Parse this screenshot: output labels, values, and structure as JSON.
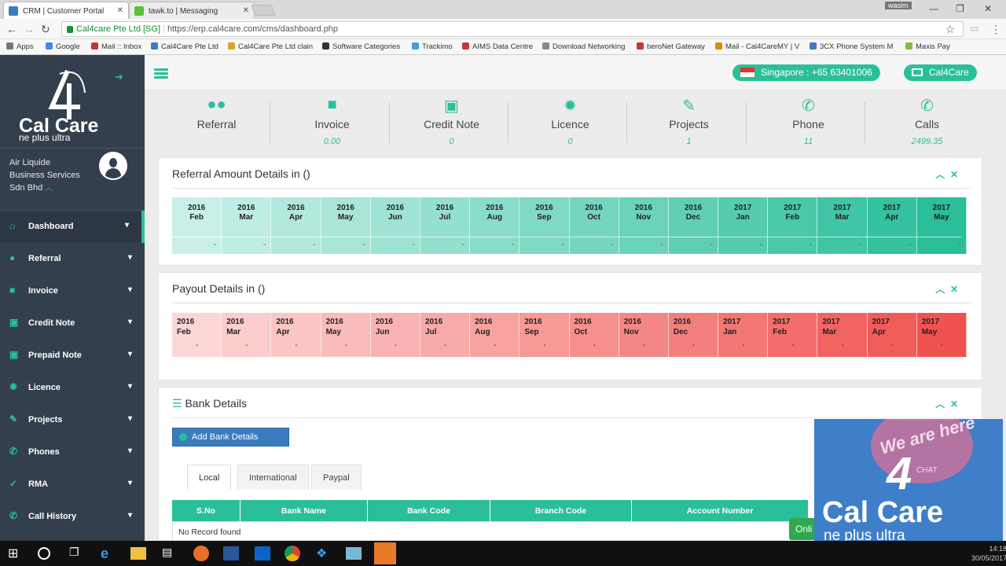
{
  "browser": {
    "tabs": [
      {
        "title": "CRM | Customer Portal"
      },
      {
        "title": "tawk.to | Messaging"
      }
    ],
    "user": "wasim",
    "secure_label": "Cal4care Pte Ltd [SG]",
    "url": "https://erp.cal4care.com/cms/dashboard.php",
    "bookmarks": [
      "Apps",
      "Google",
      "Mail :: Inbox",
      "Cal4Care Pte Ltd",
      "Cal4Care Pte Ltd clain",
      "Software Categories",
      "Trackimo",
      "AIMS Data Centre",
      "Download Networking",
      "beroNet Gateway",
      "Mail - Cal4CareMY | V",
      "3CX Phone System M",
      "Maxis Pay"
    ]
  },
  "sidebar": {
    "logo_text": "Cal Care",
    "logo_sub": "ne plus ultra",
    "company": [
      "Air Liquide",
      "Business Services",
      "Sdn Bhd"
    ],
    "menu": [
      {
        "label": "Dashboard",
        "icon": "dashboard-icon"
      },
      {
        "label": "Referral",
        "icon": "users-icon"
      },
      {
        "label": "Invoice",
        "icon": "invoice-icon"
      },
      {
        "label": "Credit Note",
        "icon": "money-icon"
      },
      {
        "label": "Prepaid Note",
        "icon": "money-icon"
      },
      {
        "label": "Licence",
        "icon": "certificate-icon"
      },
      {
        "label": "Projects",
        "icon": "edit-icon"
      },
      {
        "label": "Phones",
        "icon": "phone-icon"
      },
      {
        "label": "RMA",
        "icon": "wrench-icon"
      },
      {
        "label": "Call History",
        "icon": "phone-icon"
      }
    ]
  },
  "topbar": {
    "phone_pill": "Singapore : +65 63401006",
    "mail_pill": "Cal4Care"
  },
  "stats": [
    {
      "label": "Referral",
      "value": "",
      "icon": "users-icon"
    },
    {
      "label": "Invoice",
      "value": "0.00",
      "icon": "invoice-icon"
    },
    {
      "label": "Credit Note",
      "value": "0",
      "icon": "money-icon"
    },
    {
      "label": "Licence",
      "value": "0",
      "icon": "certificate-icon"
    },
    {
      "label": "Projects",
      "value": "1",
      "icon": "edit-icon"
    },
    {
      "label": "Phone",
      "value": "11",
      "icon": "phone-icon"
    },
    {
      "label": "Calls",
      "value": "2499.35",
      "icon": "call-icon"
    }
  ],
  "referral": {
    "title": "Referral Amount Details in ()",
    "months": [
      [
        "2016",
        "Feb"
      ],
      [
        "2016",
        "Mar"
      ],
      [
        "2016",
        "Apr"
      ],
      [
        "2016",
        "May"
      ],
      [
        "2016",
        "Jun"
      ],
      [
        "2016",
        "Jul"
      ],
      [
        "2016",
        "Aug"
      ],
      [
        "2016",
        "Sep"
      ],
      [
        "2016",
        "Oct"
      ],
      [
        "2016",
        "Nov"
      ],
      [
        "2016",
        "Dec"
      ],
      [
        "2017",
        "Jan"
      ],
      [
        "2017",
        "Feb"
      ],
      [
        "2017",
        "Mar"
      ],
      [
        "2017",
        "Apr"
      ],
      [
        "2017",
        "May"
      ]
    ],
    "values": [
      "-",
      "-",
      "-",
      "-",
      "-",
      "-",
      "-",
      "-",
      "-",
      "-",
      "-",
      "-",
      "-",
      "-",
      "-",
      "-"
    ]
  },
  "payout": {
    "title": "Payout Details in ()",
    "months": [
      [
        "2016",
        "Feb"
      ],
      [
        "2016",
        "Mar"
      ],
      [
        "2016",
        "Apr"
      ],
      [
        "2016",
        "May"
      ],
      [
        "2016",
        "Jun"
      ],
      [
        "2016",
        "Jul"
      ],
      [
        "2016",
        "Aug"
      ],
      [
        "2016",
        "Sep"
      ],
      [
        "2016",
        "Oct"
      ],
      [
        "2016",
        "Nov"
      ],
      [
        "2016",
        "Dec"
      ],
      [
        "2017",
        "Jan"
      ],
      [
        "2017",
        "Feb"
      ],
      [
        "2017",
        "Mar"
      ],
      [
        "2017",
        "Apr"
      ],
      [
        "2017",
        "May"
      ]
    ],
    "values": [
      "-",
      "-",
      "-",
      "-",
      "-",
      "-",
      "-",
      "-",
      "-",
      "-",
      "-",
      "-",
      "-",
      "-",
      "-",
      "-"
    ]
  },
  "bank": {
    "title": "Bank Details",
    "add_button": "Add Bank Details",
    "tabs": [
      "Local",
      "International",
      "Paypal"
    ],
    "columns": [
      "S.No",
      "Bank Name",
      "Bank Code",
      "Branch Code",
      "Account Number"
    ],
    "empty": "No Record found"
  },
  "chat": {
    "bubble_a": "We are here",
    "bubble_b": "CHAT",
    "logo_text": "Cal Care",
    "logo_sub": "ne plus ultra",
    "digit": "4",
    "online": "Onli"
  },
  "taskbar": {
    "time": "14:18",
    "date": "30/05/2017"
  },
  "colors": {
    "accent": "#2bbf99",
    "sidebar": "#343f4d",
    "payout_red": "#ef5350",
    "button_blue": "#3a7bbf"
  }
}
